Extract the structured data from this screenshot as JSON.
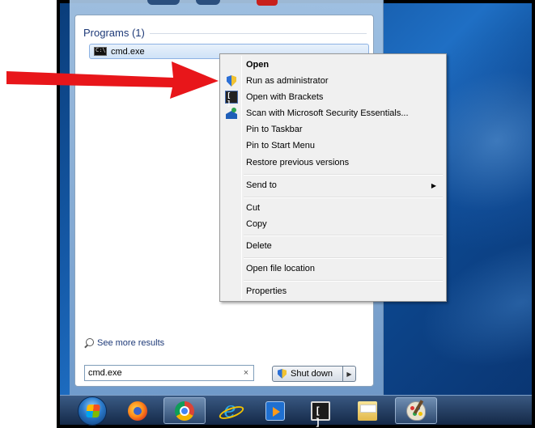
{
  "start_menu": {
    "programs_header": "Programs (1)",
    "result_item": "cmd.exe",
    "see_more": "See more results",
    "search_value": "cmd.exe",
    "search_clear": "×",
    "shutdown_label": "Shut down",
    "shutdown_arrow": "▶"
  },
  "context_menu": {
    "items": [
      {
        "label": "Open",
        "bold": true
      },
      {
        "label": "Run as administrator",
        "icon": "uac-shield-icon"
      },
      {
        "label": "Open with Brackets",
        "icon": "brackets-icon"
      },
      {
        "label": "Scan with Microsoft Security Essentials...",
        "icon": "security-essentials-icon"
      },
      {
        "label": "Pin to Taskbar"
      },
      {
        "label": "Pin to Start Menu"
      },
      {
        "label": "Restore previous versions"
      },
      {
        "label": "Send to",
        "submenu_arrow": "▶"
      },
      {
        "label": "Cut"
      },
      {
        "label": "Copy"
      },
      {
        "label": "Delete"
      },
      {
        "label": "Open file location"
      },
      {
        "label": "Properties"
      }
    ]
  },
  "annotation": {
    "arrow_color": "#e8161a",
    "points_to": "Run as administrator"
  },
  "taskbar": {
    "items": [
      "start-orb",
      "firefox-icon",
      "chrome-icon",
      "internet-explorer-icon",
      "media-player-icon",
      "brackets-icon",
      "file-explorer-icon",
      "paint-icon"
    ],
    "active": [
      "chrome-icon",
      "paint-icon"
    ]
  },
  "colors": {
    "desktop": "#155aa8",
    "menu_bg": "#f0f0f0",
    "selection": "#cfe2f7",
    "header_text": "#1e3a78"
  }
}
